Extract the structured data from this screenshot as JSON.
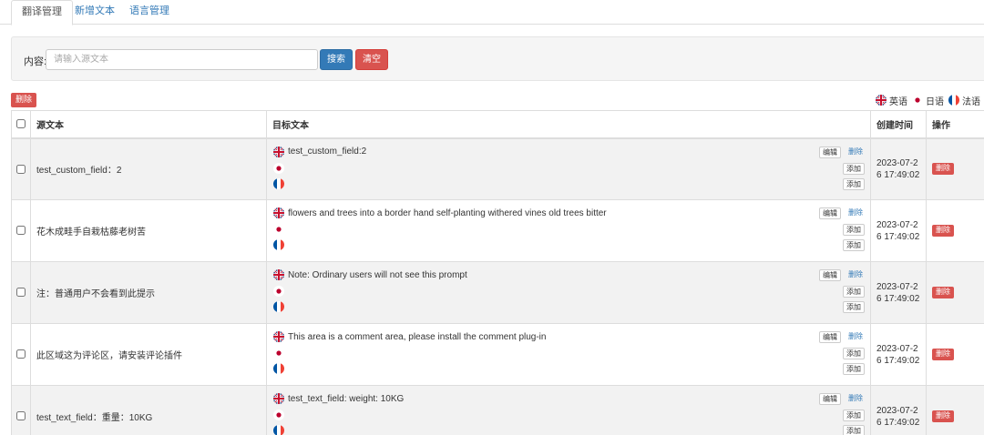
{
  "tabs": [
    {
      "label": "翻译管理",
      "active": true
    },
    {
      "label": "新增文本",
      "active": false
    },
    {
      "label": "语言管理",
      "active": false
    }
  ],
  "search": {
    "label": "内容:",
    "placeholder": "请输入源文本",
    "value": "",
    "search_button": "搜索",
    "clear_button": "清空"
  },
  "toolbar": {
    "bulk_delete_label": "删除"
  },
  "languages": [
    {
      "name": "英语",
      "flag": "uk-flag-icon"
    },
    {
      "name": "日语",
      "flag": "japan-flag-icon"
    },
    {
      "name": "法语",
      "flag": "france-flag-icon"
    }
  ],
  "table": {
    "headers": {
      "source": "源文本",
      "target": "目标文本",
      "created": "创建时间",
      "action": "操作"
    },
    "labels": {
      "edit": "编辑",
      "delete": "删除",
      "add": "添加",
      "row_delete": "删除"
    },
    "rows": [
      {
        "source": "test_custom_field：2",
        "target_en": "test_custom_field:2",
        "created": "2023-07-26 17:49:02"
      },
      {
        "source": "花木成畦手自栽枯藤老树苦",
        "target_en": "flowers and trees into a border hand self-planting withered vines old trees bitter",
        "created": "2023-07-26 17:49:02"
      },
      {
        "source": "注：普通用户不会看到此提示",
        "target_en": "Note: Ordinary users will not see this prompt",
        "created": "2023-07-26 17:49:02"
      },
      {
        "source": "此区域这为评论区，请安装评论插件",
        "target_en": "This area is a comment area, please install the comment plug-in",
        "created": "2023-07-26 17:49:02"
      },
      {
        "source": "test_text_field：重量：10KG",
        "target_en": "test_text_field: weight: 10KG",
        "created": "2023-07-26 17:49:02"
      }
    ]
  }
}
